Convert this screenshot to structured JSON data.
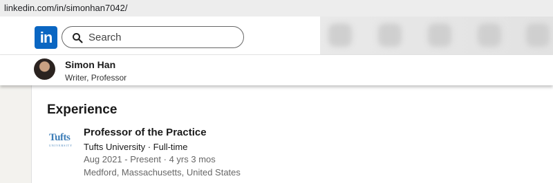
{
  "browser": {
    "url": "linkedin.com/in/simonhan7042/"
  },
  "navbar": {
    "logo_text": "in",
    "search_placeholder": "Search",
    "search_icon": "search-icon"
  },
  "profile": {
    "name": "Simon Han",
    "headline": "Writer, Professor"
  },
  "experience": {
    "section_title": "Experience",
    "items": [
      {
        "logo_text": "Tufts",
        "logo_subtext": "UNIVERSITY",
        "title": "Professor of the Practice",
        "company": "Tufts University · Full-time",
        "dates": "Aug 2021 - Present · 4 yrs 3 mos",
        "location": "Medford, Massachusetts, United States"
      }
    ]
  },
  "colors": {
    "brand": "#0a66c2",
    "tufts_blue": "#3e7eb8",
    "secondary_text": "#666666"
  }
}
